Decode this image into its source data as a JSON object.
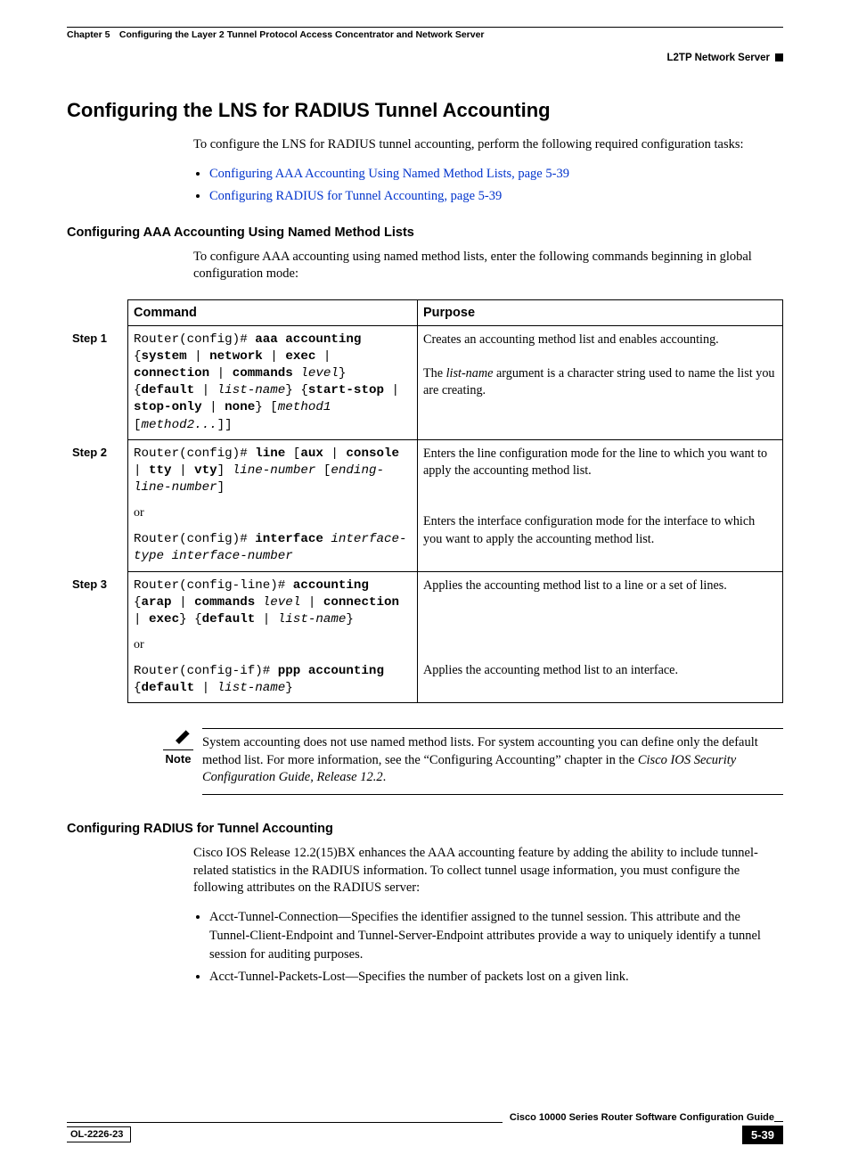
{
  "header": {
    "chapter_line": "Chapter 5 Configuring the Layer 2 Tunnel Protocol Access Concentrator and Network Server",
    "section_right": "L2TP Network Server"
  },
  "h1": "Configuring the LNS for RADIUS Tunnel Accounting",
  "intro": "To configure the LNS for RADIUS tunnel accounting, perform the following required configuration tasks:",
  "intro_links": [
    "Configuring AAA Accounting Using Named Method Lists, page 5-39",
    "Configuring RADIUS for Tunnel Accounting, page 5-39"
  ],
  "sub1": {
    "heading": "Configuring AAA Accounting Using Named Method Lists",
    "intro": "To configure AAA accounting using named method lists, enter the following commands beginning in global configuration mode:"
  },
  "table": {
    "head_command": "Command",
    "head_purpose": "Purpose",
    "rows": [
      {
        "step": "Step 1",
        "command_html": "Router(config)# <b>aaa accounting</b> {<b>system</b> | <b>network</b> | <b>exec</b> | <b>connection</b> | <b>commands</b> <i>level</i>} {<b>default</b> | <i>list-name</i>} {<b>start-stop</b> | <b>stop-only</b> | <b>none</b>} [<i>method1</i> [<i>method2...</i>]]",
        "purpose_html": "Creates an accounting method list and enables accounting.<br><br>The <i>list-name</i> argument is a character string used to name the list you are creating."
      },
      {
        "step": "Step 2",
        "command_html": "Router(config)# <b>line</b> [<b>aux</b> | <b>console</b> | <b>tty</b> | <b>vty</b>] <i>line-number</i> [<i>ending-line-number</i>]<div class='or'>or</div>Router(config)# <b>interface</b> <i>interface-type interface-number</i>",
        "purpose_html": "Enters the line configuration mode for the line to which you want to apply the accounting method list.<br><br><br>Enters the interface configuration mode for the interface to which you want to apply the accounting method list."
      },
      {
        "step": "Step 3",
        "command_html": "Router(config-line)# <b>accounting</b> {<b>arap</b> | <b>commands</b> <i>level</i> | <b>connection</b> | <b>exec</b>} {<b>default</b> | <i>list-name</i>}<div class='or'>or</div>Router(config-if)# <b>ppp accounting</b> {<b>default</b> | <i>list-name</i>}",
        "purpose_html": "Applies the accounting method list to a line or a set of lines.<br><br><br><br><br>Applies the accounting method list to an interface."
      }
    ]
  },
  "note": {
    "label": "Note",
    "text_html": "System accounting does not use named method lists. For system accounting you can define only the default method list. For more information, see the “Configuring Accounting” chapter in the <i>Cisco IOS Security Configuration Guide, Release 12.2</i>."
  },
  "sub2": {
    "heading": "Configuring RADIUS for Tunnel Accounting",
    "intro": "Cisco IOS Release 12.2(15)BX enhances the AAA accounting feature by adding the ability to include tunnel-related statistics in the RADIUS information. To collect tunnel usage information, you must configure the following attributes on the RADIUS server:",
    "bullets": [
      "Acct-Tunnel-Connection—Specifies the identifier assigned to the tunnel session. This attribute and the Tunnel-Client-Endpoint and Tunnel-Server-Endpoint attributes provide a way to uniquely identify a tunnel session for auditing purposes.",
      "Acct-Tunnel-Packets-Lost—Specifies the number of packets lost on a given link."
    ]
  },
  "footer": {
    "guide": "Cisco 10000 Series Router Software Configuration Guide",
    "ol": "OL-2226-23",
    "page": "5-39"
  }
}
